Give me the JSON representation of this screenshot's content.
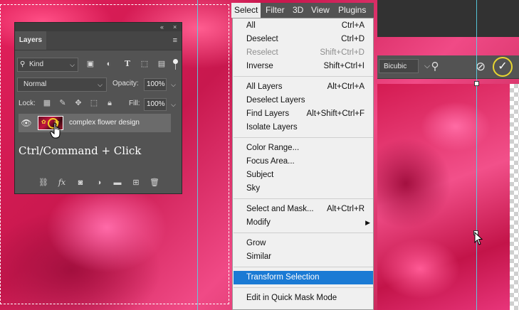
{
  "layers_panel": {
    "collapse": "«",
    "close": "×",
    "title": "Layers",
    "menu": "≡",
    "kind": "Kind",
    "blend_mode": "Normal",
    "opacity_label": "Opacity:",
    "opacity_value": "100%",
    "lock_label": "Lock:",
    "fill_label": "Fill:",
    "fill_value": "100%",
    "layer_name": "complex flower design",
    "instruction": "Ctrl/Command + Click"
  },
  "menubar": {
    "items": [
      "Select",
      "Filter",
      "3D",
      "View",
      "Plugins"
    ]
  },
  "select_menu": {
    "groups": [
      [
        {
          "label": "All",
          "shortcut": "Ctrl+A"
        },
        {
          "label": "Deselect",
          "shortcut": "Ctrl+D"
        },
        {
          "label": "Reselect",
          "shortcut": "Shift+Ctrl+D",
          "disabled": true
        },
        {
          "label": "Inverse",
          "shortcut": "Shift+Ctrl+I"
        }
      ],
      [
        {
          "label": "All Layers",
          "shortcut": "Alt+Ctrl+A"
        },
        {
          "label": "Deselect Layers",
          "shortcut": ""
        },
        {
          "label": "Find Layers",
          "shortcut": "Alt+Shift+Ctrl+F"
        },
        {
          "label": "Isolate Layers",
          "shortcut": ""
        }
      ],
      [
        {
          "label": "Color Range...",
          "shortcut": ""
        },
        {
          "label": "Focus Area...",
          "shortcut": ""
        },
        {
          "label": "Subject",
          "shortcut": ""
        },
        {
          "label": "Sky",
          "shortcut": ""
        }
      ],
      [
        {
          "label": "Select and Mask...",
          "shortcut": "Alt+Ctrl+R"
        },
        {
          "label": "Modify",
          "shortcut": "",
          "submenu": true
        }
      ],
      [
        {
          "label": "Grow",
          "shortcut": ""
        },
        {
          "label": "Similar",
          "shortcut": ""
        }
      ],
      [
        {
          "label": "Transform Selection",
          "shortcut": "",
          "highlighted": true
        }
      ],
      [
        {
          "label": "Edit in Quick Mask Mode",
          "shortcut": ""
        }
      ]
    ]
  },
  "options_bar": {
    "interpolation": "Bicubic"
  },
  "colors": {
    "menu_highlight": "#1a7ad4",
    "commit_ring": "#e8d530",
    "guide": "#58d3e8"
  }
}
